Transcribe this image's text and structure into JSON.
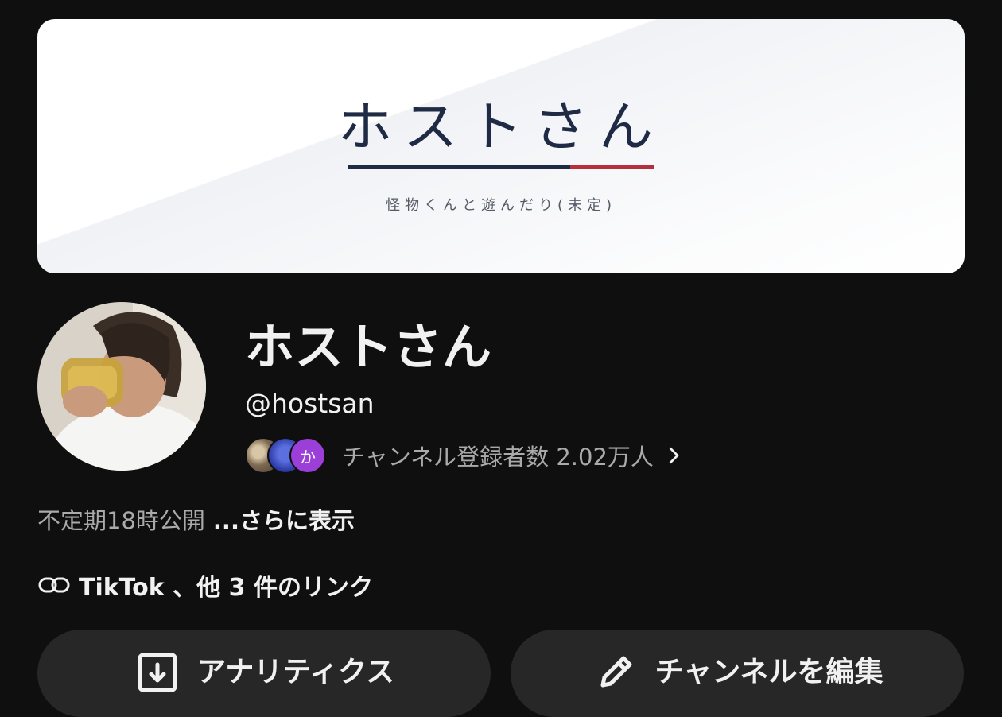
{
  "banner": {
    "title": "ホストさん",
    "subtitle": "怪物くんと遊んだり(未定)"
  },
  "channel": {
    "name": "ホストさん",
    "handle": "@hostsan",
    "subscribers_text": "チャンネル登録者数 2.02万人",
    "subscriber_avatar_3_letter": "か",
    "description": "不定期18時公開",
    "more_label": "...さらに表示",
    "links_text": "TikTok 、他 3 件のリンク"
  },
  "actions": {
    "analytics_label": "アナリティクス",
    "edit_label": "チャンネルを編集"
  },
  "colors": {
    "background": "#0f0f0f",
    "button_bg": "#272727",
    "banner_navy": "#1f2a44",
    "banner_red": "#b5303c"
  }
}
